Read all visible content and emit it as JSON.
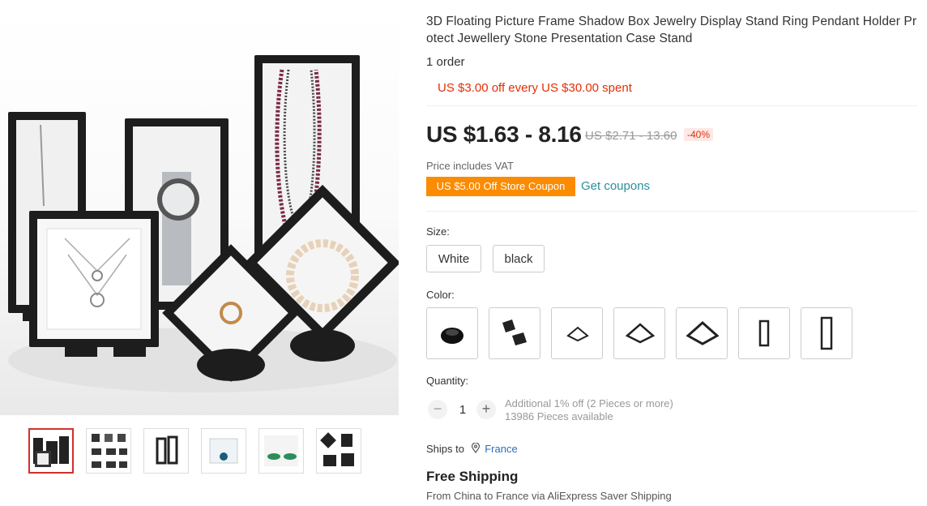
{
  "gallery": {
    "main_alt": "Floating frame jewelry display stands",
    "thumbnails": [
      "thumb-1",
      "thumb-2",
      "thumb-3",
      "thumb-4",
      "thumb-5",
      "thumb-6"
    ]
  },
  "product": {
    "title": "3D Floating Picture Frame Shadow Box Jewelry Display Stand Ring Pendant Holder Protect Jewellery Stone Presentation Case Stand",
    "orders": "1 order",
    "promo": "US $3.00 off every US $30.00 spent",
    "price": "US $1.63 - 8.16",
    "old_price": "US $2.71 - 13.60",
    "discount": "-40%",
    "vat_note": "Price includes VAT",
    "store_coupon": "US $5.00 Off Store Coupon",
    "get_coupons": "Get coupons"
  },
  "size": {
    "label": "Size:",
    "options": [
      "White",
      "black"
    ]
  },
  "color": {
    "label": "Color:",
    "option_count": 7
  },
  "quantity": {
    "label": "Quantity:",
    "value": "1",
    "minus": "−",
    "plus": "+",
    "discount_note": "Additional 1% off (2 Pieces or more)",
    "available": "13986 Pieces available"
  },
  "shipping": {
    "ships_to_label": "Ships to",
    "location": "France",
    "free_label": "Free Shipping",
    "route": "From China to France via AliExpress Saver Shipping"
  },
  "colors": {
    "price_red": "#e62e04",
    "coupon_orange": "#fb8b00",
    "link_teal": "#2b8e9c",
    "active_border": "#d0312d"
  }
}
